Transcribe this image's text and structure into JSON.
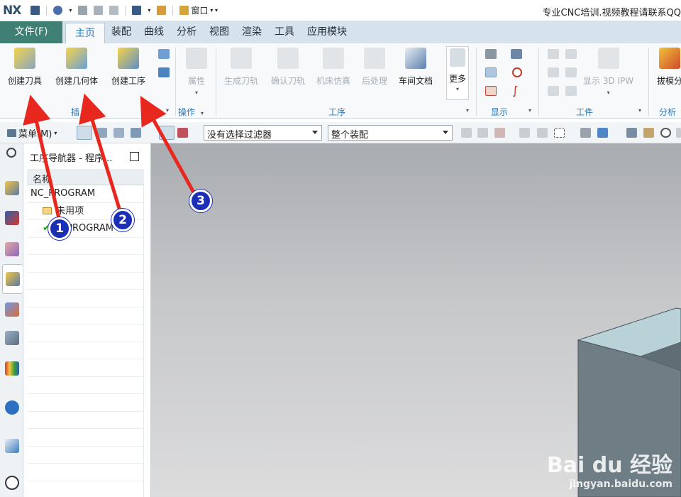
{
  "titlebar": {
    "app_logo": "NX",
    "window_menu": "窗口",
    "window_title": "专业CNC培训.视频教程请联系QQ"
  },
  "tabs": [
    "文件(F)",
    "主页",
    "装配",
    "曲线",
    "分析",
    "视图",
    "渲染",
    "工具",
    "应用模块"
  ],
  "ribbon": {
    "insert_group": {
      "buttons": [
        "创建刀具",
        "创建几何体",
        "创建工序"
      ],
      "label": "插..."
    },
    "operation_group": {
      "button": "属性",
      "label": "操作"
    },
    "process_group": {
      "buttons": [
        "生成刀轨",
        "确认刀轨",
        "机床仿真",
        "后处理",
        "车间文档",
        "更多"
      ],
      "label": "工序"
    },
    "display_group": {
      "label": "显示"
    },
    "workpiece_group": {
      "button": "显示 3D IPW",
      "label": "工件"
    },
    "analysis_group": {
      "button": "拔模分",
      "label": "分析"
    }
  },
  "toolbar": {
    "menu_label": "菜单(M)",
    "selection_filter": "没有选择过滤器",
    "assembly_scope": "整个装配"
  },
  "navigator": {
    "title": "工序导航器 - 程序...",
    "column_header": "名称",
    "rows": [
      "NC_PROGRAM",
      "未用项",
      "PROGRAM"
    ]
  },
  "markers": [
    "1",
    "2",
    "3"
  ],
  "watermark": {
    "logo": "Bai du 经验",
    "url": "jingyan.baidu.com"
  },
  "colors": {
    "file_tab": "#3f7f74",
    "tab_bar": "#d6e3ec",
    "accent_blue": "#2b78b8",
    "arrow_red": "#e8281e",
    "marker_blue": "#1b2fb6",
    "part_top": "#b8d2d7",
    "part_side": "#6f7e85"
  }
}
